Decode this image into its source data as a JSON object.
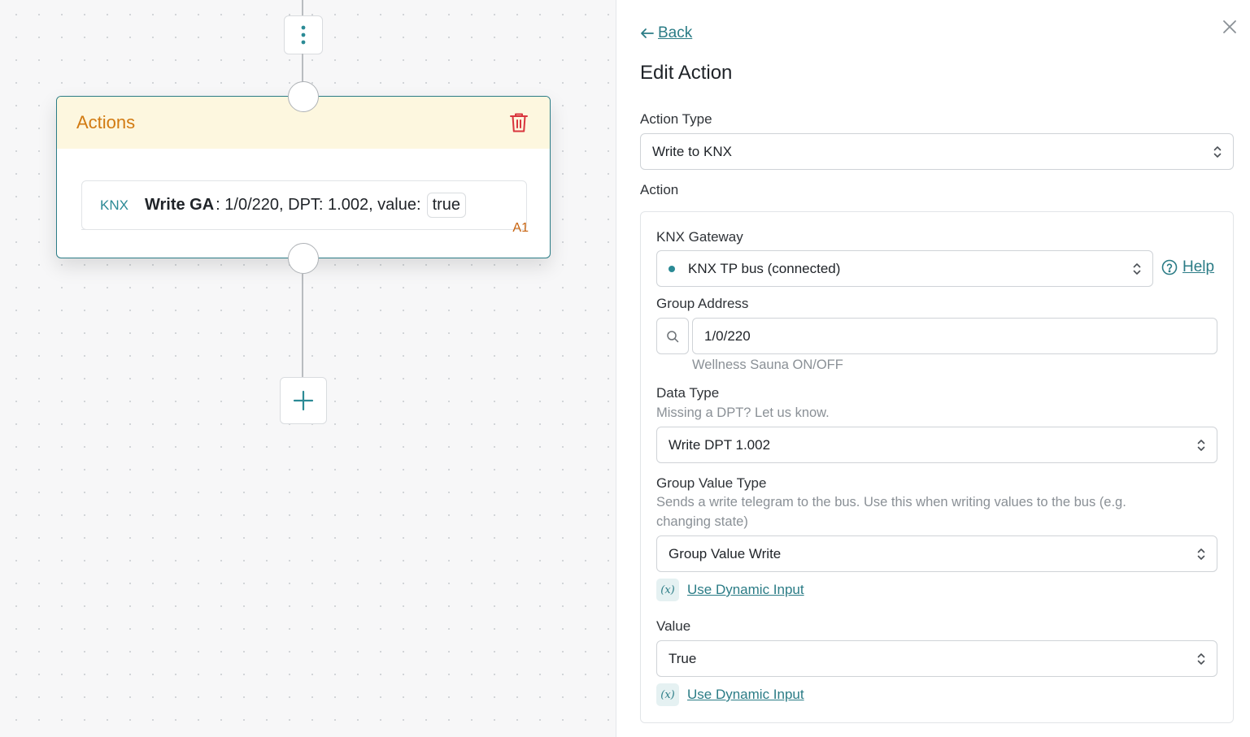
{
  "canvas": {
    "node": {
      "title": "Actions",
      "action": {
        "tag": "KNX",
        "strong": "Write GA",
        "rest": ": 1/0/220, DPT: 1.002, value:",
        "value": "true",
        "id": "A1"
      }
    }
  },
  "panel": {
    "back_label": "Back",
    "title": "Edit Action",
    "action_type": {
      "label": "Action Type",
      "value": "Write to KNX"
    },
    "action_section_label": "Action",
    "gateway": {
      "label": "KNX Gateway",
      "value": "KNX TP bus (connected)",
      "help_label": "Help"
    },
    "group_address": {
      "label": "Group Address",
      "value": "1/0/220",
      "hint": "Wellness Sauna ON/OFF"
    },
    "data_type": {
      "label": "Data Type",
      "hint": "Missing a DPT? Let us know.",
      "value": "Write DPT 1.002"
    },
    "group_value_type": {
      "label": "Group Value Type",
      "hint": "Sends a write telegram to the bus. Use this when writing values to the bus (e.g. changing state)",
      "value": "Group Value Write",
      "dynamic_label": "Use Dynamic Input"
    },
    "value_field": {
      "label": "Value",
      "value": "True",
      "dynamic_label": "Use Dynamic Input"
    }
  },
  "colors": {
    "accent": "#2b7c86",
    "node_title": "#d27b12",
    "node_header_bg": "#fdf7df",
    "trash": "#d9363e"
  }
}
